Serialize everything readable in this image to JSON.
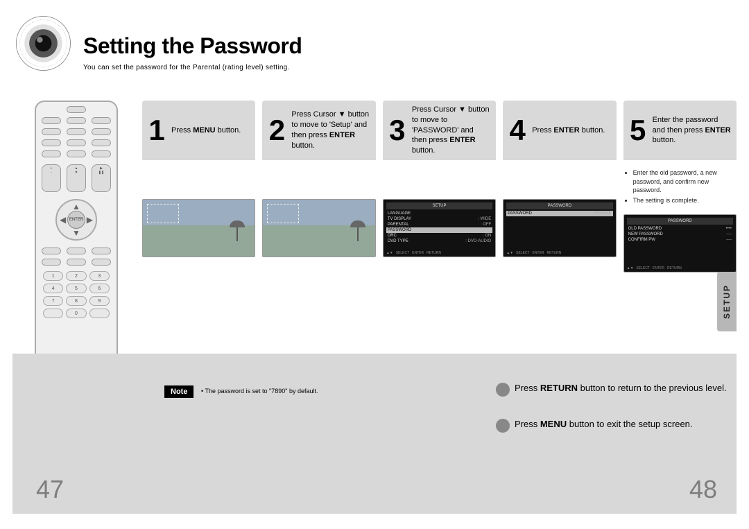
{
  "header": {
    "title": "Setting the Password",
    "subtitle": "You can set the password for the Parental (rating level) setting."
  },
  "steps": [
    {
      "num": "1",
      "parts": [
        "Press ",
        "MENU",
        " button."
      ],
      "media": "tv"
    },
    {
      "num": "2",
      "parts": [
        "Press Cursor ▼ button to move to 'Setup' and then press ",
        "ENTER",
        " button."
      ],
      "media": "tv"
    },
    {
      "num": "3",
      "parts": [
        "Press Cursor ▼ button to move to 'PASSWORD' and then press ",
        "ENTER",
        " button."
      ],
      "media": "osd_setup"
    },
    {
      "num": "4",
      "parts": [
        "Press ",
        "ENTER",
        " button."
      ],
      "media": "osd_password"
    },
    {
      "num": "5",
      "parts": [
        "Enter the password and then press ",
        "ENTER",
        " button."
      ],
      "media": "osd_change",
      "notes": [
        "Enter the old password, a new password, and confirm new password.",
        "The setting is complete."
      ]
    }
  ],
  "osd": {
    "setup_title": "SETUP",
    "setup_items": [
      {
        "l": "LANGUAGE",
        "r": ""
      },
      {
        "l": "TV DISPLAY",
        "r": ": WIDE"
      },
      {
        "l": "PARENTAL",
        "r": ": OFF"
      },
      {
        "l": "PASSWORD",
        "r": "",
        "hl": true
      },
      {
        "l": "DRC",
        "r": ": ON"
      },
      {
        "l": "DVD TYPE",
        "r": ": DVD-AUDIO"
      }
    ],
    "password_title": "PASSWORD",
    "password_items": [
      {
        "l": "PASSWORD",
        "r": "CHANGE",
        "hl": true
      }
    ],
    "change_items": [
      {
        "l": "OLD PASSWORD",
        "r": "••••"
      },
      {
        "l": "NEW PASSWORD",
        "r": "----"
      },
      {
        "l": "CONFIRM PW",
        "r": "----"
      }
    ],
    "foot": [
      "▲▼",
      "SELECT",
      "ENTER",
      "RETURN"
    ]
  },
  "note": {
    "badge": "Note",
    "text": "• The password is set to \"7890\" by default."
  },
  "footer": {
    "line1_parts": [
      "Press ",
      "RETURN",
      " button to return to the previous level."
    ],
    "line2_parts": [
      "Press ",
      "MENU",
      " button to exit the setup screen."
    ]
  },
  "sidetab": "SETUP",
  "pages": {
    "left": "47",
    "right": "48"
  },
  "remote": {
    "center": "ENTER"
  }
}
